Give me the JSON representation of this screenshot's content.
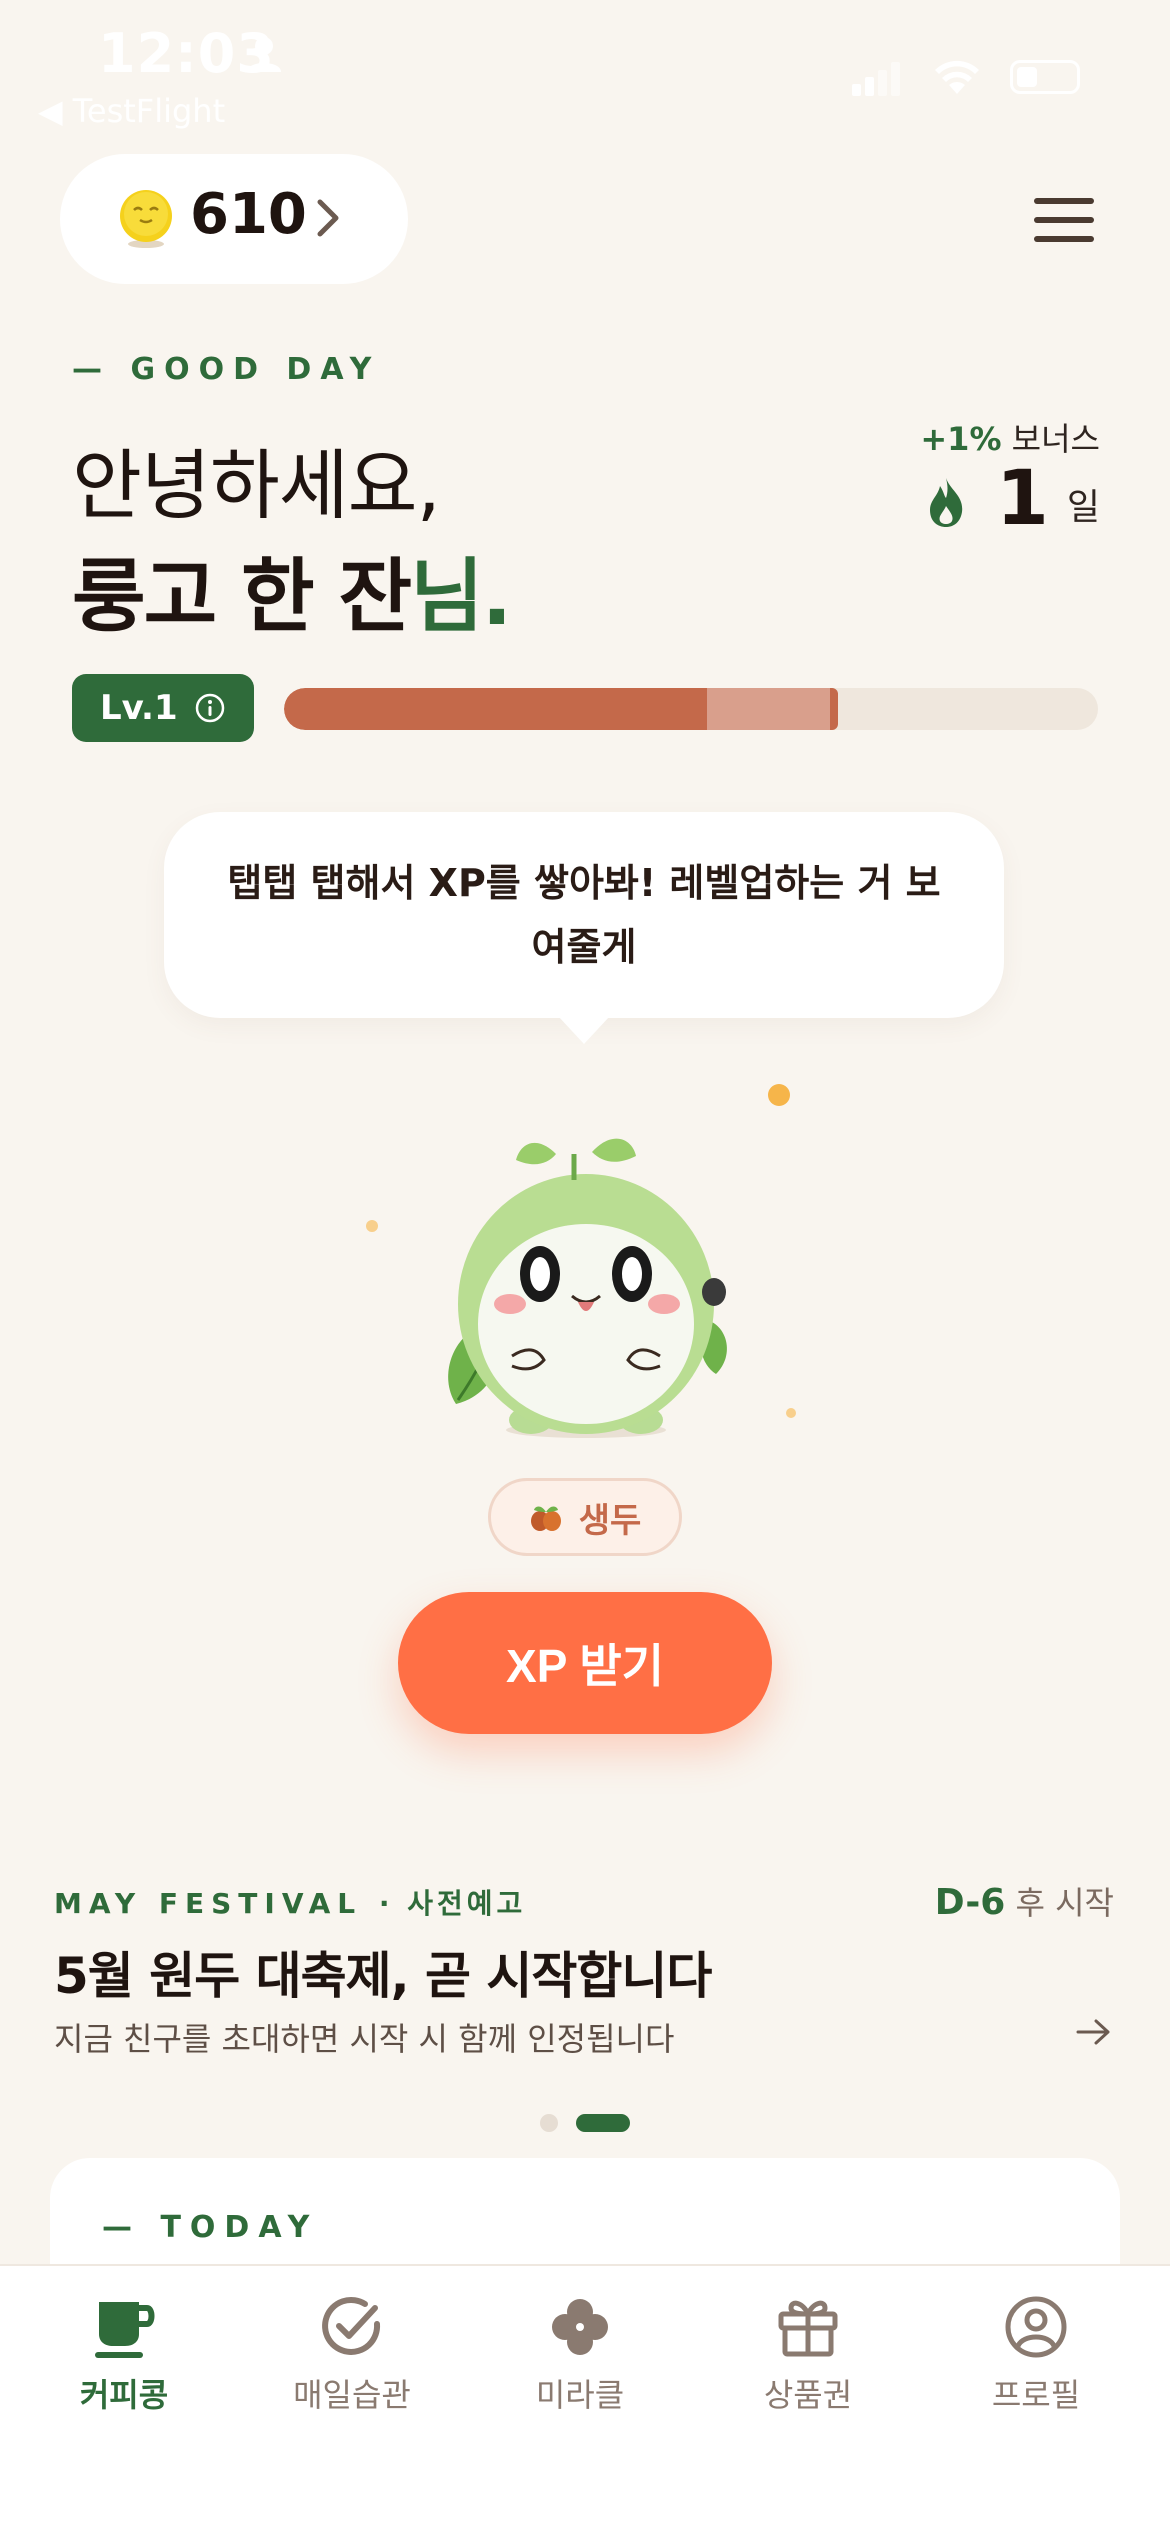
{
  "status_bar": {
    "time": "12:03",
    "back_label": "◀ TestFlight"
  },
  "header": {
    "coin_count": "610",
    "coin_icon": "coin-face-icon",
    "menu_icon": "hamburger-menu-icon"
  },
  "greeting": {
    "eyebrow": "— GOOD DAY",
    "line1": "안녕하세요,",
    "name": "룽고 한 잔",
    "honorific": "님",
    "period": "."
  },
  "streak": {
    "bonus_pct": "+1%",
    "bonus_label": "보너스",
    "days": "1",
    "unit": "일"
  },
  "level": {
    "label": "Lv.1",
    "xp_fraction": 0.52,
    "pending_fraction": 0.16
  },
  "mascot": {
    "speech": "탭탭 탭해서 XP를 쌓아봐! 레벨업하는 거 보여줄게",
    "stage_label": "생두"
  },
  "actions": {
    "xp_button": "XP 받기"
  },
  "festival": {
    "eyebrow": "MAY FESTIVAL",
    "eyebrow_sub": "· 사전예고",
    "dday": "D-6",
    "dday_suffix": "후 시작",
    "title": "5월 원두 대축제, 곧 시작합니다",
    "subtitle": "지금 친구를 초대하면 시작 시 함께 인정됩니다"
  },
  "today": {
    "label": "— TODAY"
  },
  "tabs": [
    {
      "label": "커피콩",
      "icon": "coffee-cup-icon",
      "active": true
    },
    {
      "label": "매일습관",
      "icon": "check-circle-icon",
      "active": false
    },
    {
      "label": "미라클",
      "icon": "clover-icon",
      "active": false
    },
    {
      "label": "상품권",
      "icon": "gift-icon",
      "active": false
    },
    {
      "label": "프로필",
      "icon": "profile-icon",
      "active": false
    }
  ],
  "colors": {
    "background": "#f9f5ef",
    "brand_green": "#2f6b3a",
    "accent_orange": "#ff6f45",
    "xp_bar": "#c4694a"
  }
}
